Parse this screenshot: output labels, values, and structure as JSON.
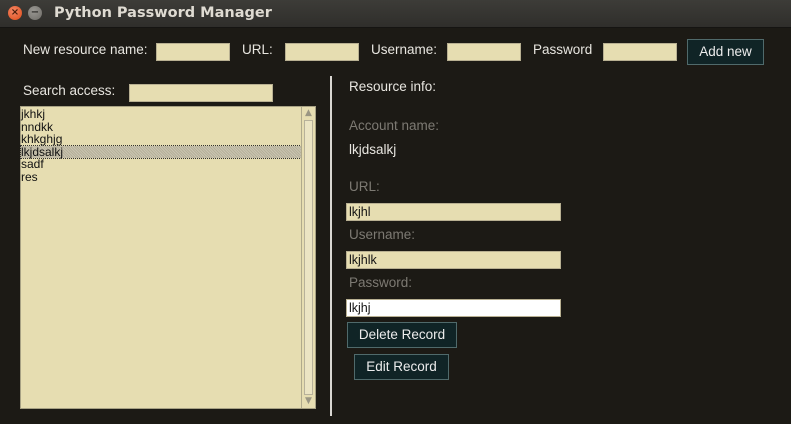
{
  "window": {
    "title": "Python Password Manager",
    "close_glyph": "×",
    "minimize_glyph": "−"
  },
  "add_form": {
    "new_resource_label": "New resource name:",
    "new_resource_value": "",
    "url_label": "URL:",
    "url_value": "",
    "username_label": "Username:",
    "username_value": "",
    "password_label": "Password",
    "password_value": "",
    "add_button": "Add new"
  },
  "search": {
    "label": "Search access:",
    "value": ""
  },
  "resource_list": {
    "items": [
      "jkhkj",
      "nndkk",
      "khkghjg",
      "lkjdsalkj",
      "sadf",
      "res"
    ],
    "selected": "lkjdsalkj",
    "scroll_up_glyph": "▲",
    "scroll_down_glyph": "▼"
  },
  "resource_info": {
    "heading": "Resource info:",
    "account_name_label": "Account name:",
    "account_name_value": "lkjdsalkj",
    "url_label": "URL:",
    "url_value": "lkjhl",
    "username_label": "Username:",
    "username_value": "lkjhlk",
    "password_label": "Password:",
    "password_value": "lkjhj",
    "delete_button": "Delete Record",
    "edit_button": "Edit Record"
  },
  "colors": {
    "background": "#1c1a15",
    "field": "#e6ddb1",
    "button": "#102426"
  }
}
